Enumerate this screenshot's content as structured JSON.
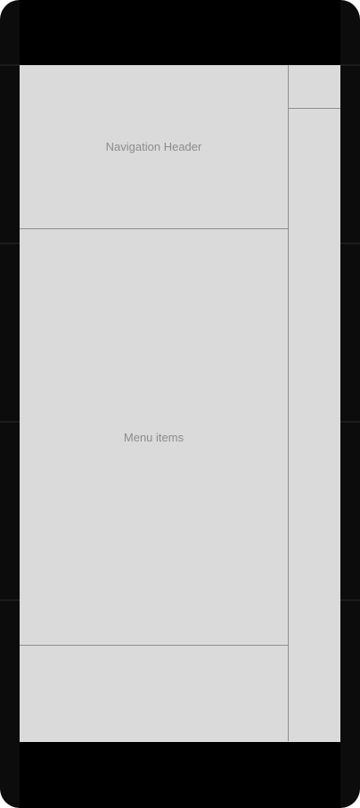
{
  "drawer": {
    "header_label": "Navigation Header",
    "menu_label": "Menu items"
  }
}
